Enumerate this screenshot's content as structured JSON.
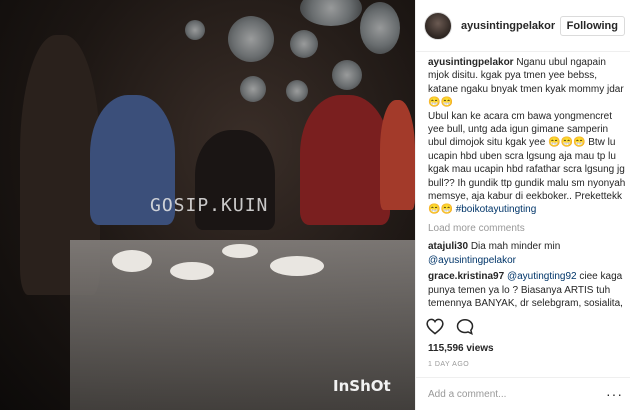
{
  "media": {
    "watermark": "GOSIP.KUIN",
    "app_label": "InShOt"
  },
  "post": {
    "username": "ayusintingpelakor",
    "follow_label": "Following",
    "caption_user": "ayusintingpelakor",
    "caption": "Nganu ubul ngapain mjok disitu. kgak pya tmen yee bebss, katane ngaku bnyak tmen kyak mommy jdar 😁😁\nUbul kan ke acara cm bawa yongmencret yee bull, untg ada igun gimane samperin ubul dimojok situ kgak yee 😁😁😁 Btw lu ucapin hbd uben scra lgsung aja mau tp lu kgak mau ucapin hbd rafathar scra lgsung jg bull?? Ih gundik ttp gundik malu sm nyonyah memsye, aja kabur di eekboker.. Prekettekk 😁😁",
    "hashtag": "#boikotayutingting",
    "load_more": "Load more comments",
    "comments": [
      {
        "user": "atajuli30",
        "text": "Dia mah minder min",
        "mention": "@ayusintingpelakor",
        "after": ""
      },
      {
        "user": "grace.kristina97",
        "text": "",
        "mention": "@ayutingting92",
        "after": "ciee kaga punya temen ya lo ? Biasanya ARTIS tuh temennya BANYAK, dr selebgram, sosialita,"
      }
    ],
    "likes": "115,596 views",
    "age": "1 DAY AGO",
    "add_comment_placeholder": "Add a comment...",
    "more_icon": "···"
  },
  "icons": {
    "like": "heart-icon",
    "comment": "comment-icon",
    "more": "more-options-icon"
  }
}
